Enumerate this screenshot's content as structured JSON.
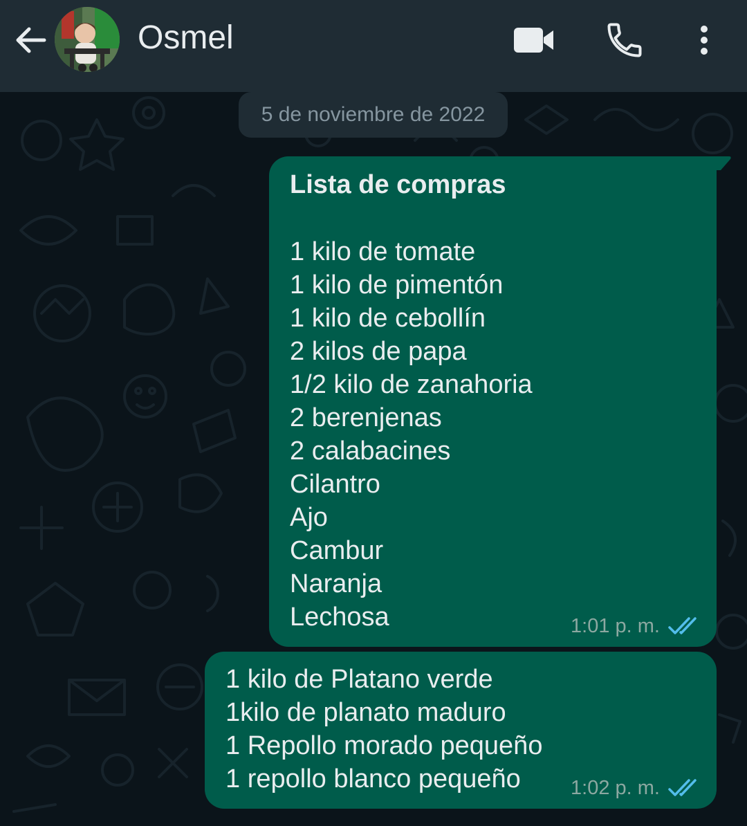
{
  "header": {
    "contact_name": "Osmel",
    "icons": {
      "back": "back-arrow-icon",
      "video": "video-call-icon",
      "call": "phone-icon",
      "menu": "more-vert-icon"
    }
  },
  "chat": {
    "date_separator": "5 de noviembre de 2022",
    "messages": [
      {
        "title": "Lista de compras",
        "lines": [
          "1 kilo de tomate",
          "1 kilo de pimentón",
          "1 kilo de cebollín",
          "2 kilos de papa",
          "1/2 kilo de zanahoria",
          "2 berenjenas",
          "2 calabacines",
          "Cilantro",
          "Ajo",
          "Cambur",
          "Naranja",
          "Lechosa"
        ],
        "time": "1:01 p. m.",
        "status": "read"
      },
      {
        "lines": [
          "1 kilo de Platano verde",
          "1kilo de planato maduro",
          "1 Repollo morado pequeño",
          "1 repollo blanco pequeño"
        ],
        "time": "1:02 p. m.",
        "status": "read"
      }
    ]
  },
  "colors": {
    "header_bg": "#1f2c34",
    "chat_bg": "#0b141a",
    "outgoing_bubble": "#005c4b",
    "read_ticks": "#53bdeb",
    "text_primary": "#e9edef"
  }
}
